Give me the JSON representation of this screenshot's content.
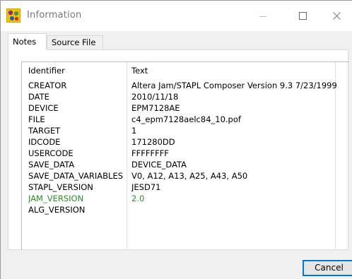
{
  "window": {
    "title": "Information",
    "app_icon": "app-icon",
    "controls": {
      "minimize_icon": "minimize-icon",
      "maximize_icon": "maximize-icon",
      "close_icon": "close-icon"
    }
  },
  "tabs": [
    {
      "label": "Notes",
      "active": true
    },
    {
      "label": "Source File",
      "active": false
    }
  ],
  "table": {
    "columns": [
      "Identifier",
      "Text"
    ],
    "rows": [
      {
        "id": "CREATOR",
        "text": "Altera Jam/STAPL Composer Version 9.3 7/23/1999"
      },
      {
        "id": "DATE",
        "text": "2010/11/18"
      },
      {
        "id": "DEVICE",
        "text": "EPM7128AE"
      },
      {
        "id": "FILE",
        "text": "c4_epm7128aelc84_10.pof"
      },
      {
        "id": "TARGET",
        "text": "1"
      },
      {
        "id": "IDCODE",
        "text": "171280DD"
      },
      {
        "id": "USERCODE",
        "text": "FFFFFFFF"
      },
      {
        "id": "SAVE_DATA",
        "text": "DEVICE_DATA"
      },
      {
        "id": "SAVE_DATA_VARIABLES",
        "text": "V0, A12, A13, A25, A43, A50"
      },
      {
        "id": "STAPL_VERSION",
        "text": "JESD71"
      },
      {
        "id": "JAM_VERSION",
        "text": "2.0",
        "highlight_color": "#2e8b2e"
      },
      {
        "id": "ALG_VERSION",
        "text": ""
      }
    ]
  },
  "buttons": {
    "cancel_label": "Cancel"
  }
}
